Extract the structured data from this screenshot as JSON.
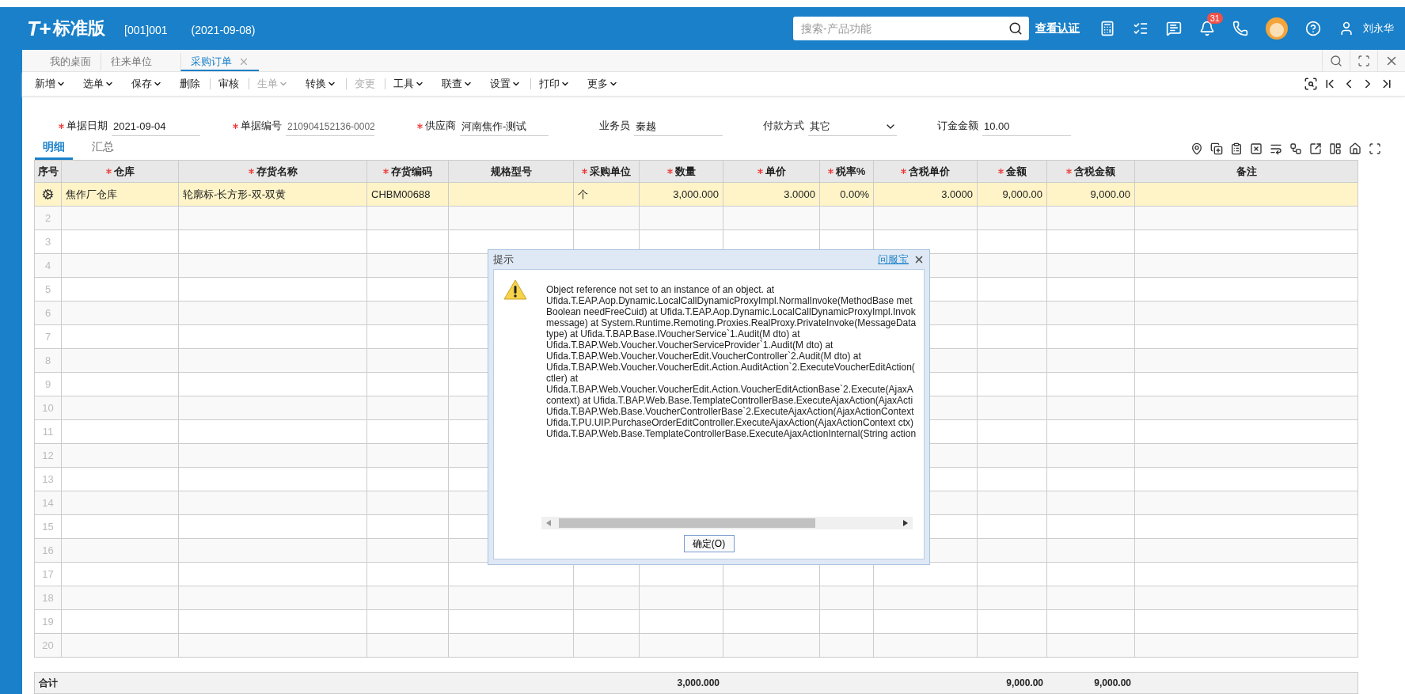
{
  "header": {
    "logo": "T+",
    "product": "标准版",
    "account": "[001]001",
    "date": "(2021-09-08)",
    "search": {
      "placeholder": "搜索-产品功能"
    },
    "cert_link": "查看认证",
    "notifications": "31",
    "user": "刘永华"
  },
  "open_tabs": [
    {
      "label": "我的桌面",
      "selected": false,
      "closable": false
    },
    {
      "label": "往来单位",
      "selected": false,
      "closable": false
    },
    {
      "label": "采购订单",
      "selected": true,
      "closable": true
    }
  ],
  "toolbar": [
    {
      "label": "新增",
      "has_menu": true,
      "disabled": false,
      "separator_before": false
    },
    {
      "label": "选单",
      "has_menu": true,
      "disabled": false,
      "separator_before": false
    },
    {
      "label": "保存",
      "has_menu": true,
      "disabled": false,
      "separator_before": false
    },
    {
      "label": "删除",
      "has_menu": false,
      "disabled": false,
      "separator_before": false
    },
    {
      "label": "审核",
      "has_menu": false,
      "disabled": false,
      "separator_before": true
    },
    {
      "label": "生单",
      "has_menu": true,
      "disabled": true,
      "separator_before": true
    },
    {
      "label": "转换",
      "has_menu": true,
      "disabled": false,
      "separator_before": false
    },
    {
      "label": "变更",
      "has_menu": false,
      "disabled": true,
      "separator_before": true
    },
    {
      "label": "工具",
      "has_menu": true,
      "disabled": false,
      "separator_before": true
    },
    {
      "label": "联查",
      "has_menu": true,
      "disabled": false,
      "separator_before": false
    },
    {
      "label": "设置",
      "has_menu": true,
      "disabled": false,
      "separator_before": false
    },
    {
      "label": "打印",
      "has_menu": true,
      "disabled": false,
      "separator_before": true
    },
    {
      "label": "更多",
      "has_menu": true,
      "disabled": false,
      "separator_before": false
    }
  ],
  "form": [
    {
      "label": "单据日期",
      "required": true,
      "value": "2021-09-04",
      "kind": "text",
      "readonly": false
    },
    {
      "label": "单据编号",
      "required": true,
      "value": "210904152136-0002",
      "kind": "text",
      "readonly": true
    },
    {
      "label": "供应商",
      "required": true,
      "value": "河南焦作-测试",
      "kind": "text",
      "readonly": false
    },
    {
      "label": "业务员",
      "required": false,
      "value": "秦越",
      "kind": "text",
      "readonly": false
    },
    {
      "label": "付款方式",
      "required": false,
      "value": "其它",
      "kind": "select",
      "readonly": false
    },
    {
      "label": "订金金额",
      "required": false,
      "value": "10.00",
      "kind": "text",
      "readonly": false
    }
  ],
  "detail_tabs": [
    {
      "label": "明细",
      "selected": true
    },
    {
      "label": "汇总",
      "selected": false
    }
  ],
  "table": {
    "columns": [
      {
        "label": "序号",
        "required": false,
        "kind": "index"
      },
      {
        "label": "仓库",
        "required": true,
        "kind": "text"
      },
      {
        "label": "存货名称",
        "required": true,
        "kind": "text"
      },
      {
        "label": "存货编码",
        "required": true,
        "kind": "text"
      },
      {
        "label": "规格型号",
        "required": false,
        "kind": "text"
      },
      {
        "label": "采购单位",
        "required": true,
        "kind": "text"
      },
      {
        "label": "数量",
        "required": true,
        "kind": "number",
        "total": "3,000.000"
      },
      {
        "label": "单价",
        "required": true,
        "kind": "number"
      },
      {
        "label": "税率%",
        "required": true,
        "kind": "number"
      },
      {
        "label": "含税单价",
        "required": true,
        "kind": "number"
      },
      {
        "label": "金额",
        "required": true,
        "kind": "number",
        "total": "9,000.00"
      },
      {
        "label": "含税金额",
        "required": true,
        "kind": "number",
        "total": "9,000.00"
      },
      {
        "label": "备注",
        "required": false,
        "kind": "text"
      }
    ],
    "rows": [
      {
        "selected": true,
        "cells": [
          "焦作厂仓库",
          "轮廓标-长方形-双-双黄",
          "CHBM00688",
          null,
          "个",
          "3,000.000",
          "3.0000",
          "0.00%",
          "3.0000",
          "9,000.00",
          "9,000.00",
          null
        ]
      },
      {
        "number": "2",
        "selected": false
      },
      {
        "number": "3",
        "selected": false
      },
      {
        "number": "4",
        "selected": false
      },
      {
        "number": "5",
        "selected": false
      },
      {
        "number": "6",
        "selected": false
      },
      {
        "number": "7",
        "selected": false
      },
      {
        "number": "8",
        "selected": false
      },
      {
        "number": "9",
        "selected": false
      },
      {
        "number": "10",
        "selected": false
      },
      {
        "number": "11",
        "selected": false
      },
      {
        "number": "12",
        "selected": false
      },
      {
        "number": "13",
        "selected": false
      },
      {
        "number": "14",
        "selected": false
      },
      {
        "number": "15",
        "selected": false
      },
      {
        "number": "16",
        "selected": false
      },
      {
        "number": "17",
        "selected": false
      },
      {
        "number": "18",
        "selected": false
      },
      {
        "number": "19",
        "selected": false
      },
      {
        "number": "20",
        "selected": false
      }
    ],
    "total_label": "合计"
  },
  "dialog": {
    "title": "提示",
    "help_link": "问服宝",
    "message_lines": [
      "Object reference not set to an instance of an object. at",
      "Ufida.T.EAP.Aop.Dynamic.LocalCallDynamicProxyImpl.NormalInvoke(MethodBase met",
      "Boolean needFreeCuid) at Ufida.T.EAP.Aop.Dynamic.LocalCallDynamicProxyImpl.Invok",
      "message) at System.Runtime.Remoting.Proxies.RealProxy.PrivateInvoke(MessageData",
      "type) at Ufida.T.BAP.Base.IVoucherService`1.Audit(M dto) at",
      "Ufida.T.BAP.Web.Voucher.VoucherServiceProvider`1.Audit(M dto) at",
      "Ufida.T.BAP.Web.Voucher.VoucherEdit.VoucherController`2.Audit(M dto) at",
      "Ufida.T.BAP.Web.Voucher.VoucherEdit.Action.AuditAction`2.ExecuteVoucherEditAction(",
      "ctler) at",
      "Ufida.T.BAP.Web.Voucher.VoucherEdit.Action.VoucherEditActionBase`2.Execute(AjaxA",
      "context) at Ufida.T.BAP.Web.Base.TemplateControllerBase.ExecuteAjaxAction(AjaxActi",
      "Ufida.T.BAP.Web.Base.VoucherControllerBase`2.ExecuteAjaxAction(AjaxActionContext",
      "Ufida.T.PU.UIP.PurchaseOrderEditController.ExecuteAjaxAction(AjaxActionContext ctx)",
      "Ufida.T.BAP.Web.Base.TemplateControllerBase.ExecuteAjaxActionInternal(String action"
    ],
    "button": "确定(O)"
  }
}
